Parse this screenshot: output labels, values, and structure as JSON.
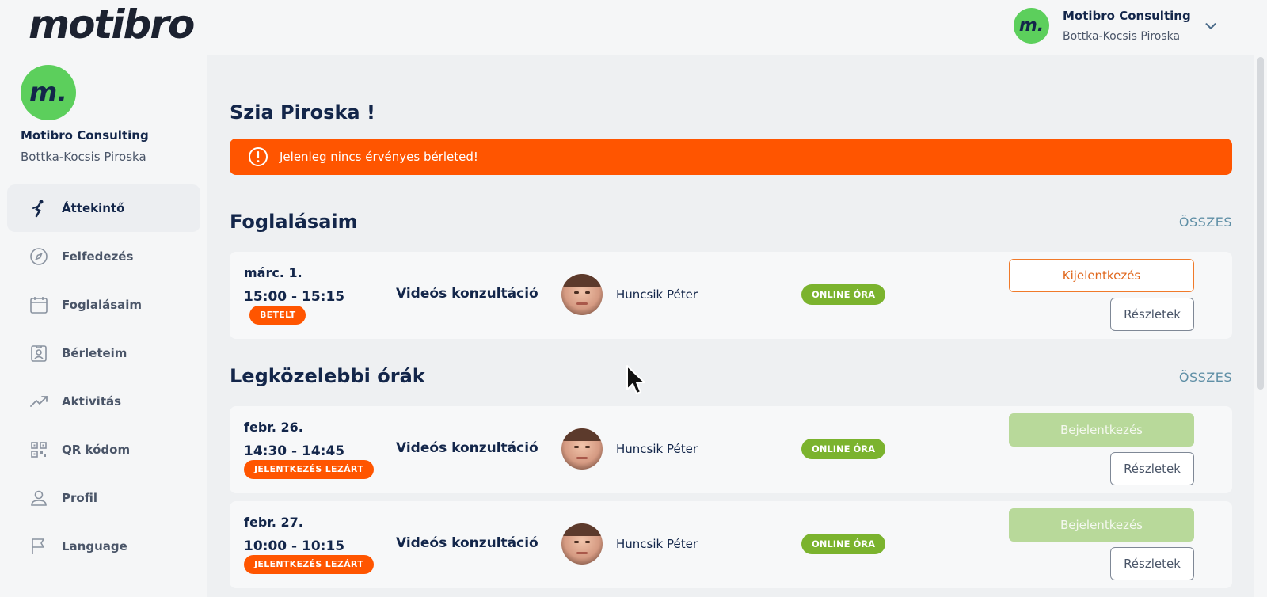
{
  "brand": {
    "logo_text": "motibro",
    "avatar_letter": "m."
  },
  "user": {
    "company": "Motibro Consulting",
    "name": "Bottka-Kocsis Piroska"
  },
  "nav": {
    "items": [
      {
        "label": "Áttekintő",
        "icon": "runner-icon",
        "active": true
      },
      {
        "label": "Felfedezés",
        "icon": "compass-icon"
      },
      {
        "label": "Foglalásaim",
        "icon": "calendar-icon"
      },
      {
        "label": "Bérleteim",
        "icon": "id-badge-icon"
      },
      {
        "label": "Aktivitás",
        "icon": "trend-icon"
      },
      {
        "label": "QR kódom",
        "icon": "qr-code-icon"
      },
      {
        "label": "Profil",
        "icon": "user-icon"
      },
      {
        "label": "Language",
        "icon": "flag-icon"
      }
    ]
  },
  "main": {
    "greeting": "Szia Piroska !",
    "alert": "Jelenleg nincs érvényes bérleted!",
    "bookings": {
      "title": "Foglalásaim",
      "see_all": "ÖSSZES",
      "items": [
        {
          "date": "márc. 1.",
          "time": "15:00 - 15:15",
          "badge": "BETELT",
          "title": "Videós konzultáció",
          "coach": "Huncsik Péter",
          "tag": "ONLINE ÓRA",
          "primary_action": "Kijelentkezés",
          "details": "Részletek"
        }
      ]
    },
    "upcoming": {
      "title": "Legközelebbi órák",
      "see_all": "ÖSSZES",
      "items": [
        {
          "date": "febr. 26.",
          "time": "14:30 - 14:45",
          "badge": "JELENTKEZÉS LEZÁRT",
          "title": "Videós konzultáció",
          "coach": "Huncsik Péter",
          "tag": "ONLINE ÓRA",
          "primary_action": "Bejelentkezés",
          "details": "Részletek"
        },
        {
          "date": "febr. 27.",
          "time": "10:00 - 10:15",
          "badge": "JELENTKEZÉS LEZÁRT",
          "title": "Videós konzultáció",
          "coach": "Huncsik Péter",
          "tag": "ONLINE ÓRA",
          "primary_action": "Bejelentkezés",
          "details": "Részletek"
        }
      ]
    }
  },
  "colors": {
    "brand_green": "#5ccf5c",
    "alert_orange": "#ff5500",
    "online_green": "#7bb32e",
    "navy": "#13264a"
  }
}
